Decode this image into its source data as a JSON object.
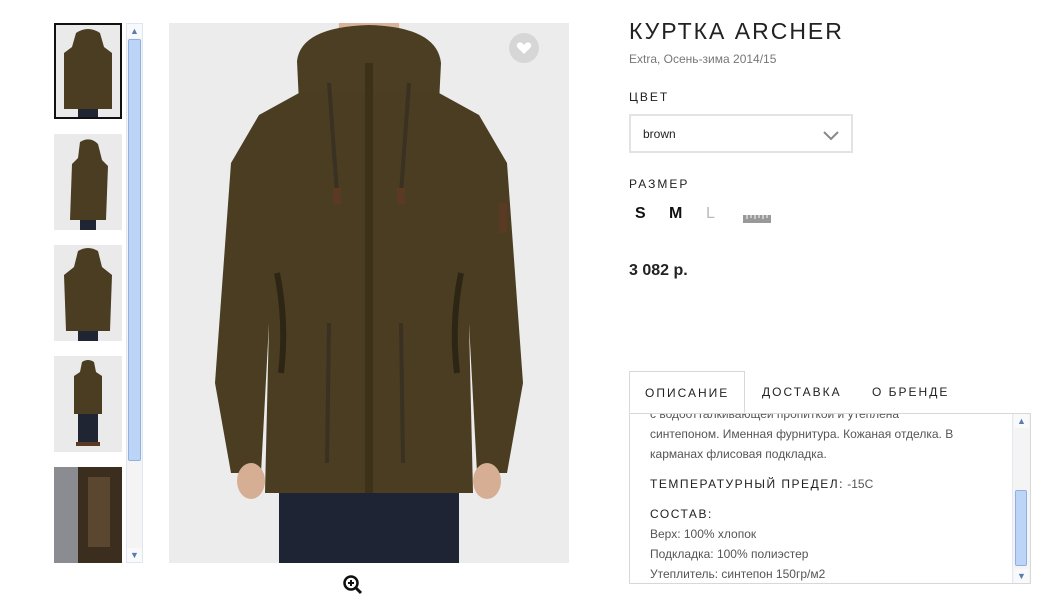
{
  "product": {
    "title": "КУРТКА ARCHER",
    "subtitle": "Extra, Осень-зима 2014/15",
    "price": "3 082 р."
  },
  "color": {
    "label": "ЦВЕТ",
    "selected": "brown"
  },
  "size": {
    "label": "РАЗМЕР",
    "options": [
      {
        "label": "S",
        "available": true
      },
      {
        "label": "M",
        "available": true
      },
      {
        "label": "L",
        "available": false
      }
    ]
  },
  "gallery": {
    "thumbnail_count": 5,
    "active_index": 0,
    "scroll_position": 0.0
  },
  "tabs": [
    {
      "label": "ОПИСАНИЕ"
    },
    {
      "label": "ДОСТАВКА"
    },
    {
      "label": "О БРЕНДЕ"
    }
  ],
  "description": {
    "lines": [
      "с водоотталкивающей пропиткой и утеплена",
      "синтепоном. Именная фурнитура. Кожаная отделка. В",
      "карманах флисовая подкладка."
    ],
    "temp_label": "ТЕМПЕРАТУРНЫЙ ПРЕДЕЛ:",
    "temp_value": "-15С",
    "composition_label": "СОСТАВ:",
    "composition": [
      "Верх: 100% хлопок",
      "Подкладка: 100% полиэстер",
      "Утеплитель: синтепон 150гр/м2"
    ]
  },
  "icons": {
    "favorite": "heart-icon",
    "zoom": "zoom-in-icon",
    "dropdown": "chevron-down-icon",
    "size_guide": "ruler-icon"
  },
  "colors": {
    "jacket": "#4a3d22",
    "scroll_thumb": "#bcd4f6",
    "panel_border": "#d8d8d8"
  }
}
